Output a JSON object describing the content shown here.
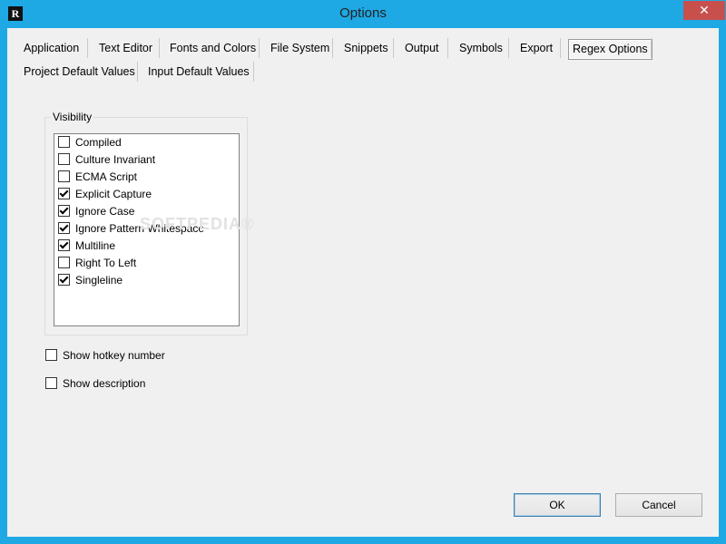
{
  "window": {
    "title": "Options",
    "app_icon": "R",
    "close_glyph": "✕"
  },
  "tabs": [
    {
      "label": "Application"
    },
    {
      "label": "Text Editor"
    },
    {
      "label": "Fonts and Colors"
    },
    {
      "label": "File System"
    },
    {
      "label": "Snippets"
    },
    {
      "label": "Output"
    },
    {
      "label": "Symbols"
    },
    {
      "label": "Export"
    },
    {
      "label": "Regex Options",
      "active": true
    },
    {
      "label": "Project Default Values"
    },
    {
      "label": "Input Default Values"
    }
  ],
  "visibility": {
    "label": "Visibility",
    "items": [
      {
        "label": "Compiled",
        "checked": false
      },
      {
        "label": "Culture Invariant",
        "checked": false
      },
      {
        "label": "ECMA Script",
        "checked": false
      },
      {
        "label": "Explicit Capture",
        "checked": true
      },
      {
        "label": "Ignore Case",
        "checked": true
      },
      {
        "label": "Ignore Pattern Whitespace",
        "checked": true
      },
      {
        "label": "Multiline",
        "checked": true
      },
      {
        "label": "Right To Left",
        "checked": false
      },
      {
        "label": "Singleline",
        "checked": true
      }
    ]
  },
  "options": {
    "show_hotkey_number": {
      "label": "Show hotkey number",
      "checked": false
    },
    "show_description": {
      "label": "Show description",
      "checked": false
    }
  },
  "buttons": {
    "ok": "OK",
    "cancel": "Cancel"
  },
  "watermark": "SOFTPEDIA®",
  "colors": {
    "titlebar": "#1ea8e4",
    "close": "#c7504d"
  }
}
